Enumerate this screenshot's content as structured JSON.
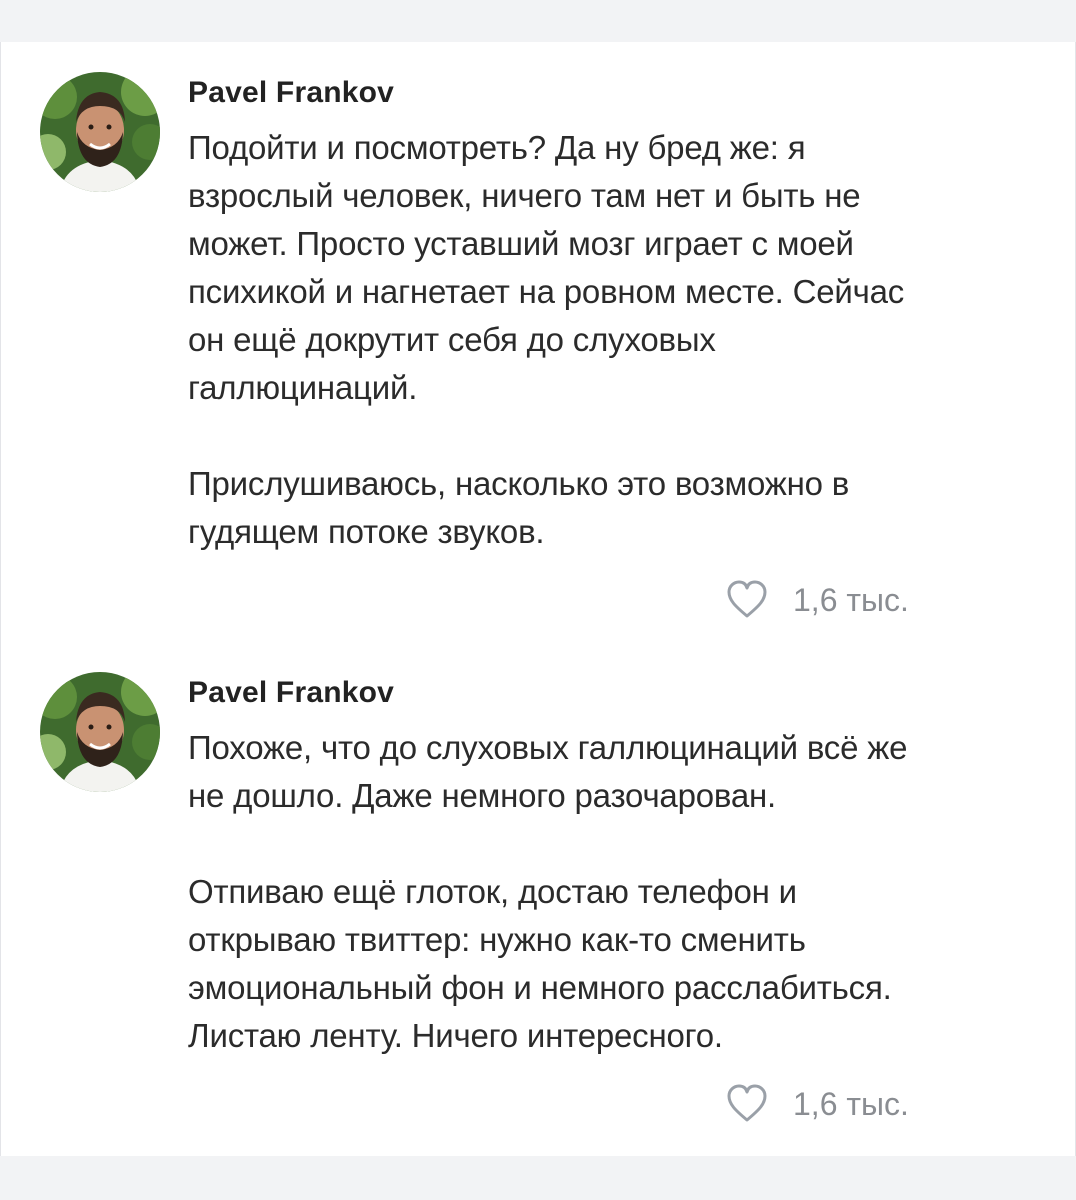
{
  "colors": {
    "page_background": "#f2f3f5",
    "card_background": "#ffffff",
    "text": "#2b2b2b",
    "muted": "#8a8d92",
    "heart_outline": "#9aa0a8"
  },
  "posts": [
    {
      "author": "Pavel Frankov",
      "avatar_icon": "avatar-photo",
      "paragraphs": [
        "Подойти и посмотреть? Да ну бред же: я\nвзрослый человек, ничего там нет и быть не\nможет. Просто уставший мозг играет с моей\nпсихикой и нагнетает на ровном месте. Сейчас\nон ещё докрутит себя до слуховых\nгаллюцинаций.",
        "Прислушиваюсь, насколько это возможно в\nгудящем потоке звуков."
      ],
      "like_icon": "heart-icon",
      "likes": "1,6 тыс."
    },
    {
      "author": "Pavel Frankov",
      "avatar_icon": "avatar-photo",
      "paragraphs": [
        "Похоже, что до слуховых галлюцинаций всё же\nне дошло. Даже немного разочарован.",
        "Отпиваю ещё глоток, достаю телефон и\nоткрываю твиттер: нужно как-то сменить\nэмоциональный фон и немного расслабиться.\nЛистаю ленту. Ничего интересного."
      ],
      "like_icon": "heart-icon",
      "likes": "1,6 тыс."
    }
  ]
}
